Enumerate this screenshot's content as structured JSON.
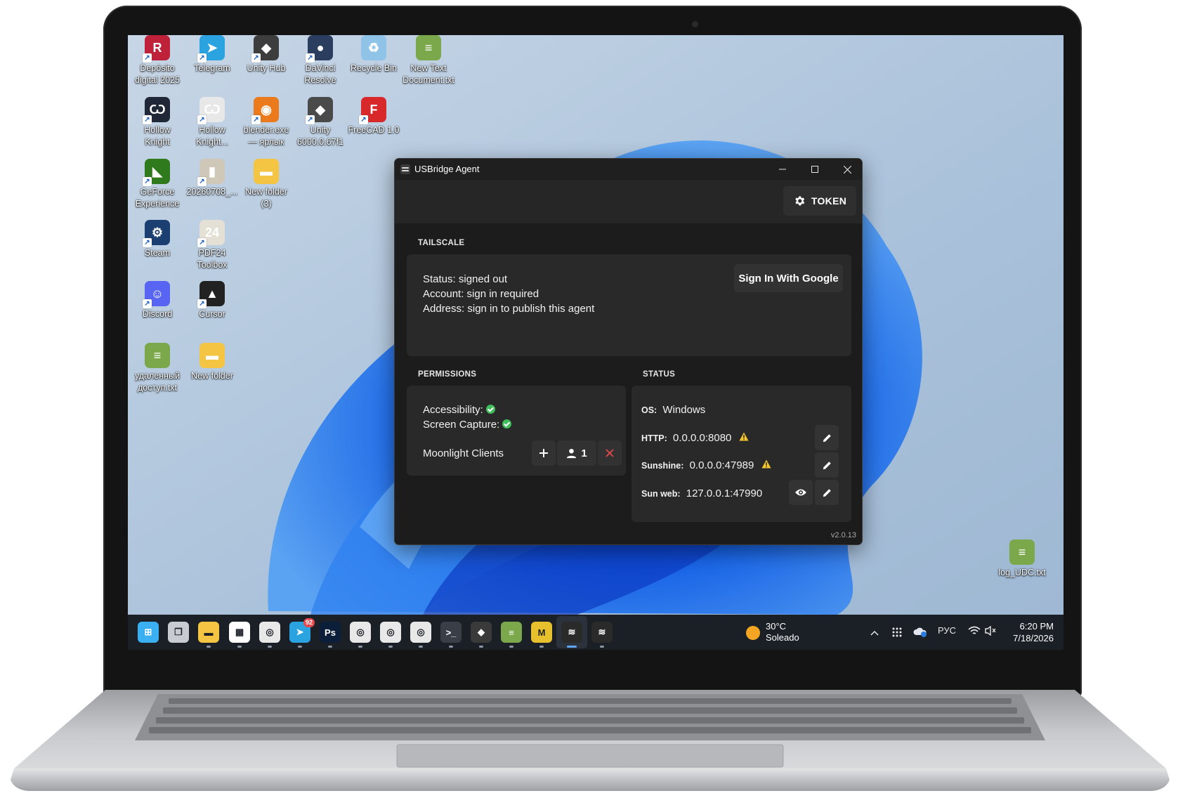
{
  "desktop": {
    "icons": [
      {
        "label": "Depósito\ndigital 2025",
        "icon": "deposito-icon",
        "color": "#c0213a",
        "glyph": "R"
      },
      {
        "label": "Telegram",
        "icon": "telegram-icon",
        "color": "#2aa3e0",
        "glyph": "➤"
      },
      {
        "label": "Unity Hub",
        "icon": "unity-hub-icon",
        "color": "#3d3d3d",
        "glyph": "◆"
      },
      {
        "label": "DaVinci\nResolve",
        "icon": "davinci-icon",
        "color": "#2c3e60",
        "glyph": "●"
      },
      {
        "label": "Recycle Bin",
        "icon": "recycle-bin-icon",
        "color": "#8fc3e8",
        "glyph": "♻"
      },
      {
        "label": "New Text\nDocument.txt",
        "icon": "text-file-icon",
        "color": "#7aa84b",
        "glyph": "≡"
      },
      {
        "label": "Hollow\nKnight",
        "icon": "hollow-knight-icon",
        "color": "#202838",
        "glyph": "Ѡ"
      },
      {
        "label": "Hollow\nKnight...",
        "icon": "hollow-knight-icon",
        "color": "#e8e8e8",
        "glyph": "Ѡ"
      },
      {
        "label": "blender.exe\n— ярлык",
        "icon": "blender-icon",
        "color": "#ea7a1c",
        "glyph": "◉"
      },
      {
        "label": "Unity\n6000.0.67f1",
        "icon": "unity-icon",
        "color": "#4a4a4a",
        "glyph": "◆"
      },
      {
        "label": "FreeCAD 1.0",
        "icon": "freecad-icon",
        "color": "#d8282a",
        "glyph": "F"
      },
      {
        "label": "GeForce\nExperience",
        "icon": "geforce-icon",
        "color": "#2f7a1c",
        "glyph": "◣"
      },
      {
        "label": "20260708_...",
        "icon": "file-icon",
        "color": "#cfc8b9",
        "glyph": "▮"
      },
      {
        "label": "New folder\n(3)",
        "icon": "folder-icon",
        "color": "#f4c542",
        "glyph": "▬"
      },
      {
        "label": "Steam",
        "icon": "steam-icon",
        "color": "#1b3f70",
        "glyph": "⚙"
      },
      {
        "label": "PDF24\nToolbox",
        "icon": "pdf24-icon",
        "color": "#e5e0d6",
        "glyph": "24"
      },
      {
        "label": "Discord",
        "icon": "discord-icon",
        "color": "#5865f2",
        "glyph": "☺"
      },
      {
        "label": "Cursor",
        "icon": "cursor-icon",
        "color": "#222222",
        "glyph": "▲"
      },
      {
        "label": "удаленный\nдоступ.txt",
        "icon": "text-file-icon",
        "color": "#7aa84b",
        "glyph": "≡"
      },
      {
        "label": "New folder",
        "icon": "folder-icon",
        "color": "#f4c542",
        "glyph": "▬"
      },
      {
        "label": "log_UDC.txt",
        "icon": "text-file-icon",
        "color": "#7aa84b",
        "glyph": "≡"
      }
    ]
  },
  "taskbar": {
    "apps": [
      {
        "icon": "windows-start-icon",
        "color": "#3ab0f3",
        "glyph": "⊞"
      },
      {
        "icon": "task-view-icon",
        "color": "#c8ccd2",
        "glyph": "❐"
      },
      {
        "icon": "file-explorer-icon",
        "color": "#f4c542",
        "glyph": "▬"
      },
      {
        "icon": "microsoft-store-icon",
        "color": "#ffffff",
        "glyph": "▦"
      },
      {
        "icon": "chrome-icon",
        "color": "#e8e8e8",
        "glyph": "◎"
      },
      {
        "icon": "telegram-icon",
        "color": "#2aa3e0",
        "glyph": "➤",
        "badge": "92"
      },
      {
        "icon": "photoshop-icon",
        "color": "#0b1f3b",
        "glyph": "Ps"
      },
      {
        "icon": "chrome-icon",
        "color": "#e8e8e8",
        "glyph": "◎"
      },
      {
        "icon": "chrome-icon",
        "color": "#e8e8e8",
        "glyph": "◎"
      },
      {
        "icon": "chrome-icon",
        "color": "#e8e8e8",
        "glyph": "◎"
      },
      {
        "icon": "terminal-icon",
        "color": "#3a3f47",
        "glyph": ">_"
      },
      {
        "icon": "unity-icon",
        "color": "#3a3a3a",
        "glyph": "◆"
      },
      {
        "icon": "notepad-icon",
        "color": "#7aa84b",
        "glyph": "≡"
      },
      {
        "icon": "mojito-icon",
        "color": "#e7c02e",
        "glyph": "M"
      },
      {
        "icon": "usbridge-icon",
        "color": "#2a2a2a",
        "glyph": "≋",
        "active": true
      },
      {
        "icon": "usbridge-icon",
        "color": "#2a2a2a",
        "glyph": "≋"
      }
    ],
    "weather": {
      "temp": "30°C",
      "condition": "Soleado"
    },
    "language": "РУС",
    "time": "6:20 PM",
    "date": "7/18/2026"
  },
  "window": {
    "title": "USBridge Agent",
    "toolbar": {
      "token_label": "TOKEN"
    },
    "tailscale": {
      "heading": "TAILSCALE",
      "status_line": "Status: signed out",
      "account_line": "Account: sign in required",
      "address_line": "Address: sign in to publish this agent",
      "sign_in_label": "Sign In With Google"
    },
    "permissions": {
      "heading": "PERMISSIONS",
      "accessibility_label": "Accessibility:",
      "screen_capture_label": "Screen Capture:",
      "moonlight_label": "Moonlight Clients",
      "client_count": "1"
    },
    "status": {
      "heading": "STATUS",
      "os_label": "OS:",
      "os_value": "Windows",
      "http_label": "HTTP:",
      "http_value": "0.0.0.0:8080",
      "sunshine_label": "Sunshine:",
      "sunshine_value": "0.0.0.0:47989",
      "sunweb_label": "Sun web:",
      "sunweb_value": "127.0.0.1:47990"
    },
    "version": "v2.0.13"
  },
  "colors": {
    "accent_ok": "#3fbf5a",
    "warning": "#f2c531",
    "danger": "#e5484d",
    "window_bg": "#1c1c1c",
    "card_bg": "#292929"
  }
}
